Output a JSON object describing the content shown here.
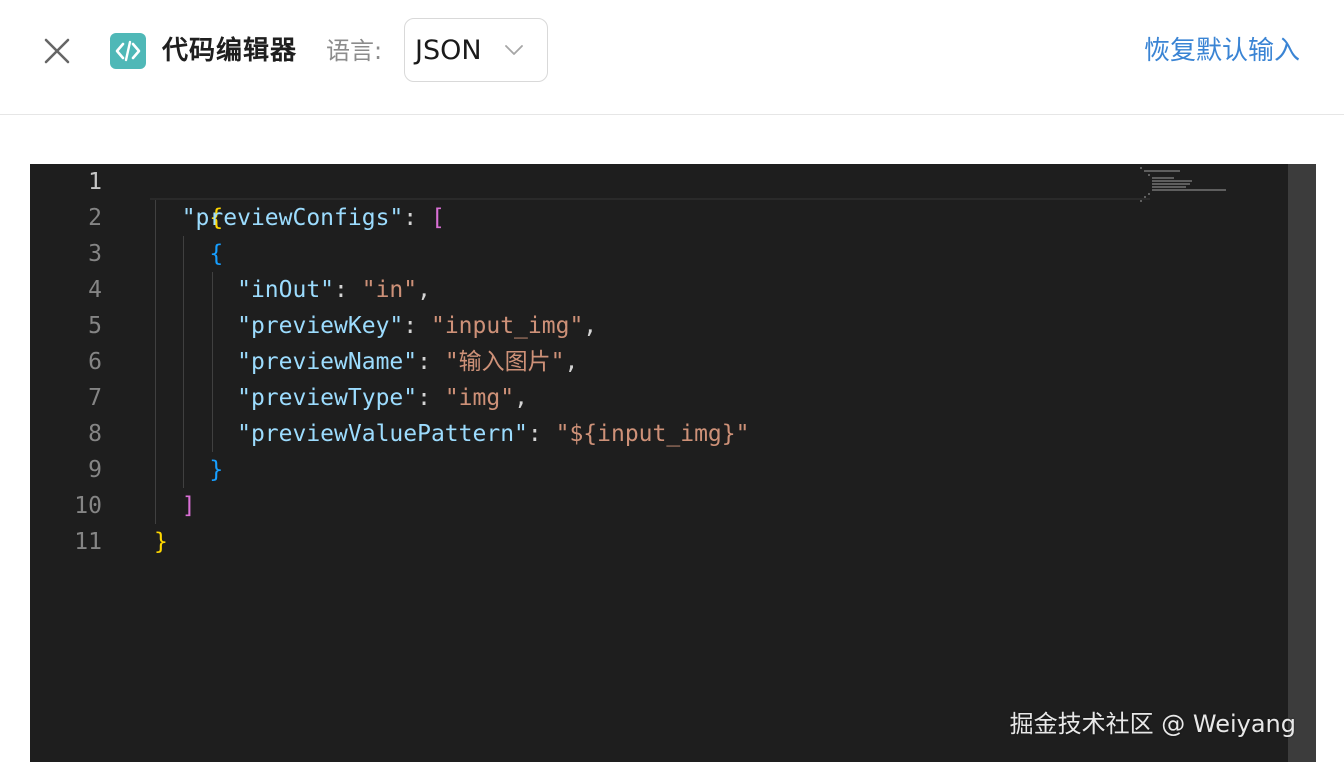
{
  "header": {
    "close_icon": "close-icon",
    "app_icon": "code-icon",
    "title": "代码编辑器",
    "language_label": "语言:",
    "language_value": "JSON",
    "reset_label": "恢复默认输入"
  },
  "editor": {
    "line_numbers": [
      "1",
      "2",
      "3",
      "4",
      "5",
      "6",
      "7",
      "8",
      "9",
      "10",
      "11"
    ],
    "active_line": "1",
    "lines": [
      {
        "b1": "{"
      },
      {
        "k": "\"previewConfigs\"",
        "p": ": ",
        "b2": "["
      },
      {
        "b3": "{"
      },
      {
        "k": "\"inOut\"",
        "p": ": ",
        "s": "\"in\"",
        "p2": ","
      },
      {
        "k": "\"previewKey\"",
        "p": ": ",
        "s": "\"input_img\"",
        "p2": ","
      },
      {
        "k": "\"previewName\"",
        "p": ": ",
        "s": "\"输入图片\"",
        "p2": ","
      },
      {
        "k": "\"previewType\"",
        "p": ": ",
        "s": "\"img\"",
        "p2": ","
      },
      {
        "k": "\"previewValuePattern\"",
        "p": ": ",
        "s": "\"${input_img}\""
      },
      {
        "b3": "}"
      },
      {
        "b2": "]"
      },
      {
        "b1": "}"
      }
    ]
  },
  "watermark": "掘金技术社区 @ Weiyang",
  "colors": {
    "accent": "#3a84d4",
    "app_icon_bg": "#4fb8b7",
    "editor_bg": "#1e1e1e",
    "json_key": "#9cdcfe",
    "json_string": "#ce9178"
  }
}
